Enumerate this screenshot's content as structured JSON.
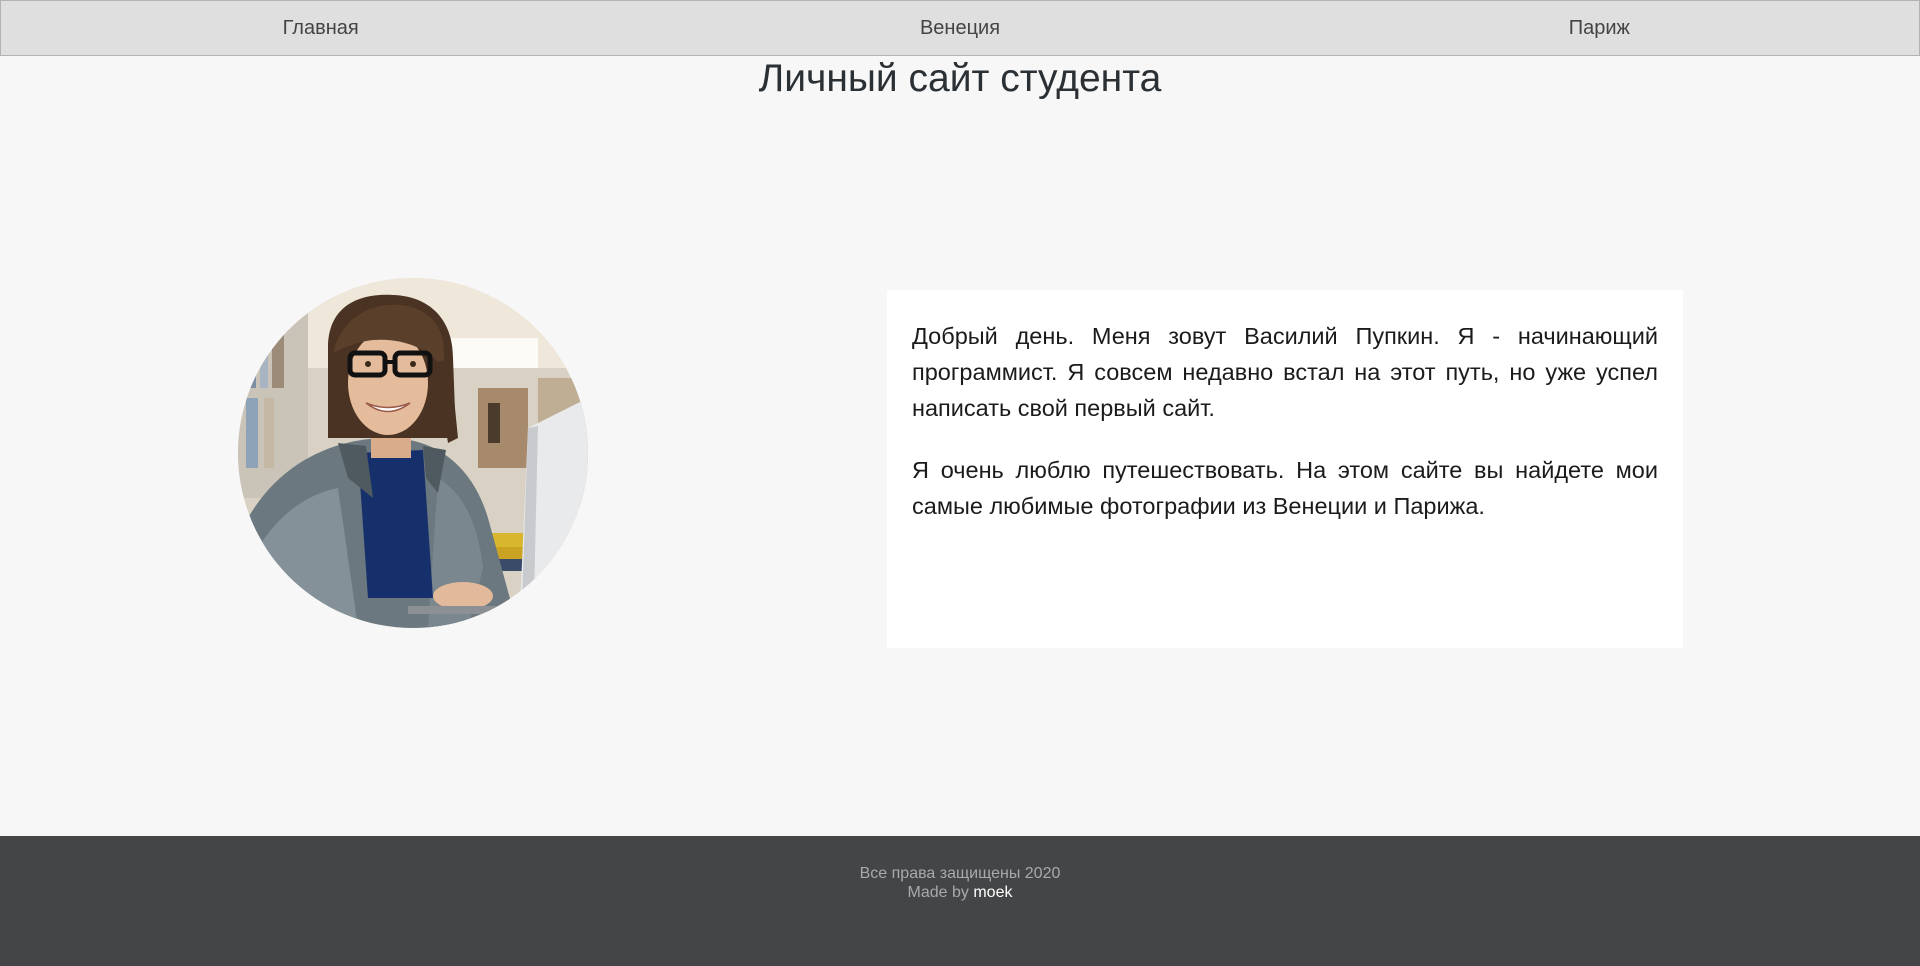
{
  "nav": {
    "items": [
      {
        "label": "Главная"
      },
      {
        "label": "Венеция"
      },
      {
        "label": "Париж"
      }
    ]
  },
  "main": {
    "title": "Личный сайт студента",
    "avatar": {
      "icon": "student-photo"
    },
    "paragraphs": [
      "Добрый день. Меня зовут Василий Пупкин. Я - начинающий программист. Я совсем недавно встал на этот путь, но уже успел написать свой первый сайт.",
      "Я очень люблю путешествовать. На этом сайте вы найдете мои самые любимые фотографии из Венеции и Парижа."
    ]
  },
  "footer": {
    "copyright": "Все права защищены 2020",
    "made_by_prefix": "Made by",
    "author": "moek"
  },
  "colors": {
    "nav_bg": "#dfdfdf",
    "page_bg": "#f7f7f7",
    "card_bg": "#ffffff",
    "footer_bg": "#444547",
    "footer_text": "#a8a9ab",
    "author_link": "#ffffff"
  }
}
